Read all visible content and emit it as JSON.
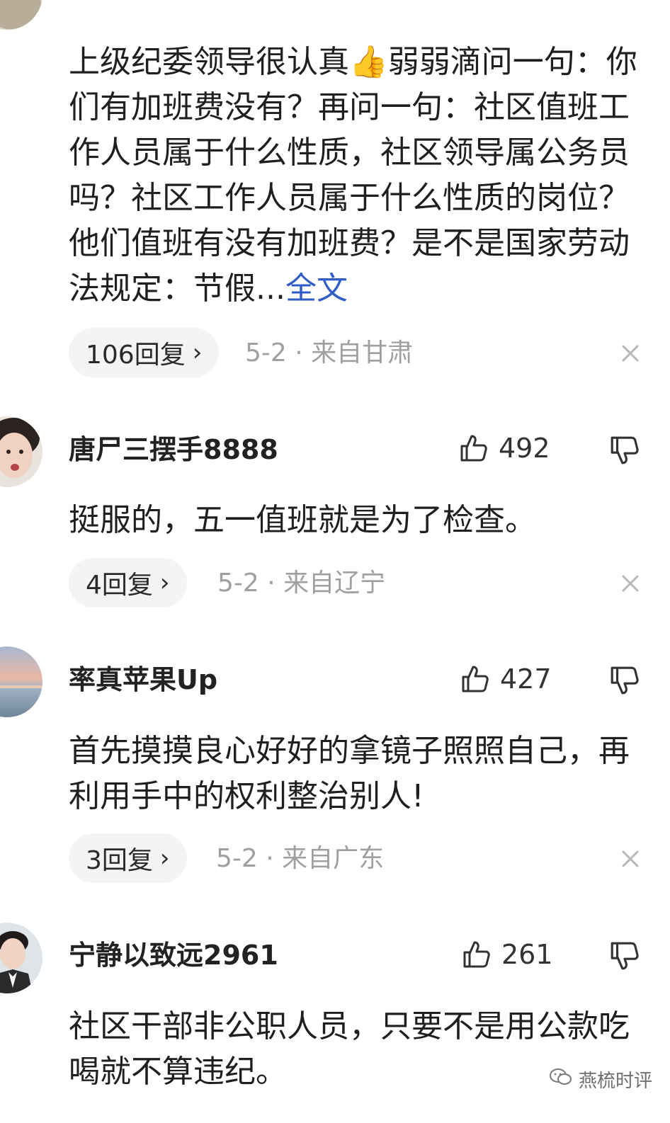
{
  "comments": [
    {
      "username": "",
      "likes": "",
      "body": "上级纪委领导很认真👍弱弱滴问一句：你们有加班费没有？再问一句：社区值班工作人员属于什么性质，社区领导属公务员吗？社区工作人员属于什么性质的岗位？他们值班有没有加班费？是不是国家劳动法规定：节假...",
      "more_label": "全文",
      "reply_label": "106回复",
      "meta": "5-2 · 来自甘肃"
    },
    {
      "username": "唐尸三摆手8888",
      "likes": "492",
      "body": "挺服的，五一值班就是为了检查。",
      "reply_label": "4回复",
      "meta": "5-2 · 来自辽宁"
    },
    {
      "username": "率真苹果Up",
      "likes": "427",
      "body": "首先摸摸良心好好的拿镜子照照自己，再利用手中的权利整治别人!",
      "reply_label": "3回复",
      "meta": "5-2 · 来自广东"
    },
    {
      "username": "宁静以致远2961",
      "likes": "261",
      "body": "社区干部非公职人员，只要不是用公款吃喝就不算违纪。"
    }
  ],
  "icons": {
    "like": "thumbs-up-icon",
    "dislike": "thumbs-down-icon",
    "close": "close-icon",
    "chevron": "chevron-right-icon"
  },
  "watermark": {
    "text": "燕梳时评"
  },
  "colors": {
    "link": "#2f5cc6",
    "meta": "#a0a0a0",
    "pill": "#f4f4f4"
  }
}
